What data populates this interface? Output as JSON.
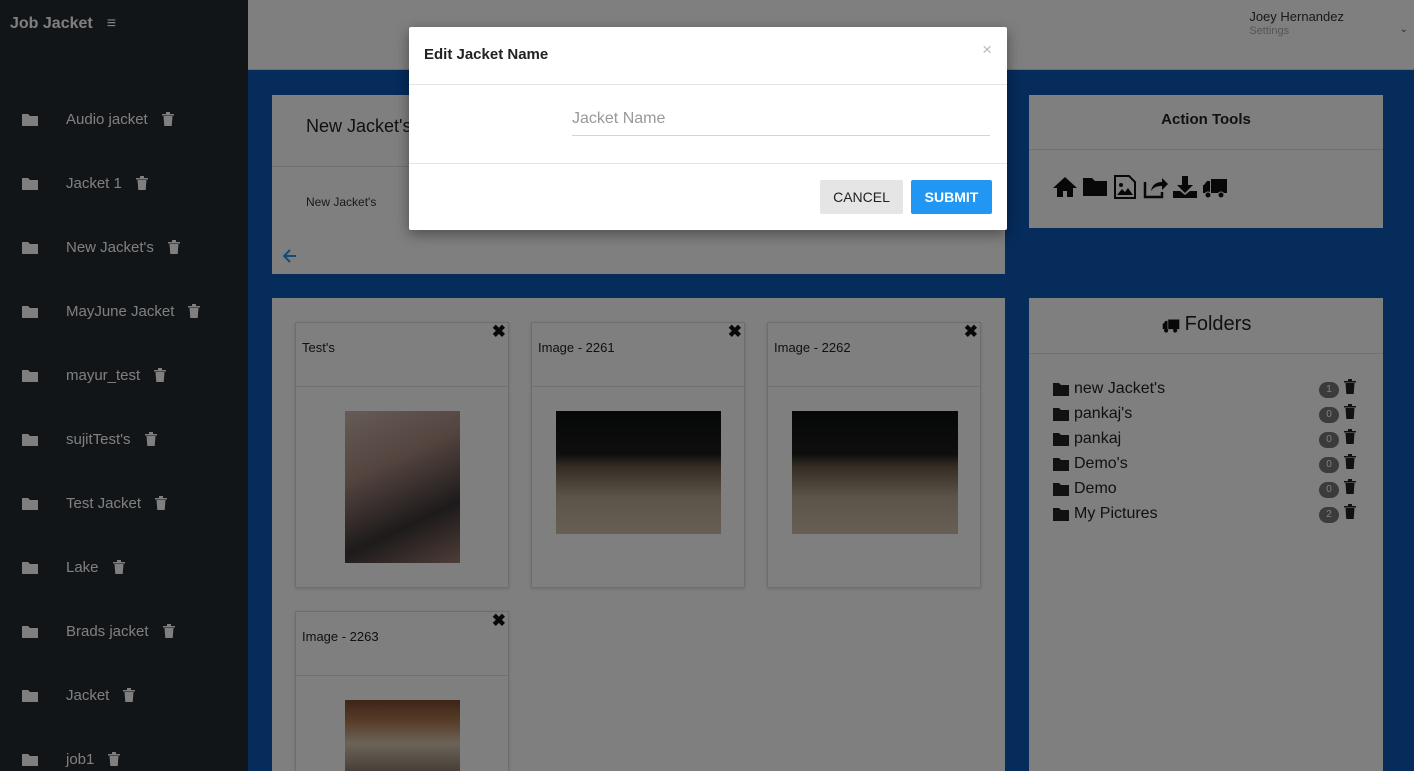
{
  "app": {
    "brand": "Job Jacket",
    "menu_icon": "hamburger-icon"
  },
  "user": {
    "name": "Joey Hernandez",
    "settings_label": "Settings"
  },
  "sidebar": {
    "items": [
      {
        "label": "Audio jacket"
      },
      {
        "label": "Jacket 1"
      },
      {
        "label": "New Jacket's"
      },
      {
        "label": "MayJune Jacket"
      },
      {
        "label": "mayur_test"
      },
      {
        "label": "sujitTest's"
      },
      {
        "label": "Test Jacket"
      },
      {
        "label": "Lake"
      },
      {
        "label": "Brads jacket"
      },
      {
        "label": "Jacket"
      },
      {
        "label": "job1"
      }
    ]
  },
  "jacket": {
    "title": "New Jacket's",
    "subtitle": "New Jacket's"
  },
  "action_tools": {
    "title": "Action Tools",
    "icons": [
      "home-icon",
      "folder-icon",
      "image-icon",
      "share-icon",
      "download-icon",
      "truck-icon"
    ]
  },
  "images": {
    "cards": [
      {
        "title": "Test's"
      },
      {
        "title": "Image - 2261"
      },
      {
        "title": "Image - 2262"
      },
      {
        "title": "Image - 2263"
      }
    ]
  },
  "folders": {
    "title": "Folders",
    "items": [
      {
        "name": "new Jacket's",
        "count": "1"
      },
      {
        "name": "pankaj's",
        "count": "0"
      },
      {
        "name": "pankaj",
        "count": "0"
      },
      {
        "name": "Demo's",
        "count": "0"
      },
      {
        "name": "Demo",
        "count": "0"
      },
      {
        "name": "My Pictures",
        "count": "2"
      }
    ]
  },
  "modal": {
    "title": "Edit Jacket Name",
    "close_glyph": "×",
    "input_placeholder": "Jacket Name",
    "input_value": "",
    "cancel_label": "CANCEL",
    "submit_label": "SUBMIT"
  },
  "colors": {
    "accent": "#2196f3",
    "page_bg": "#0a58b7",
    "sidebar_bg": "#242a31"
  }
}
